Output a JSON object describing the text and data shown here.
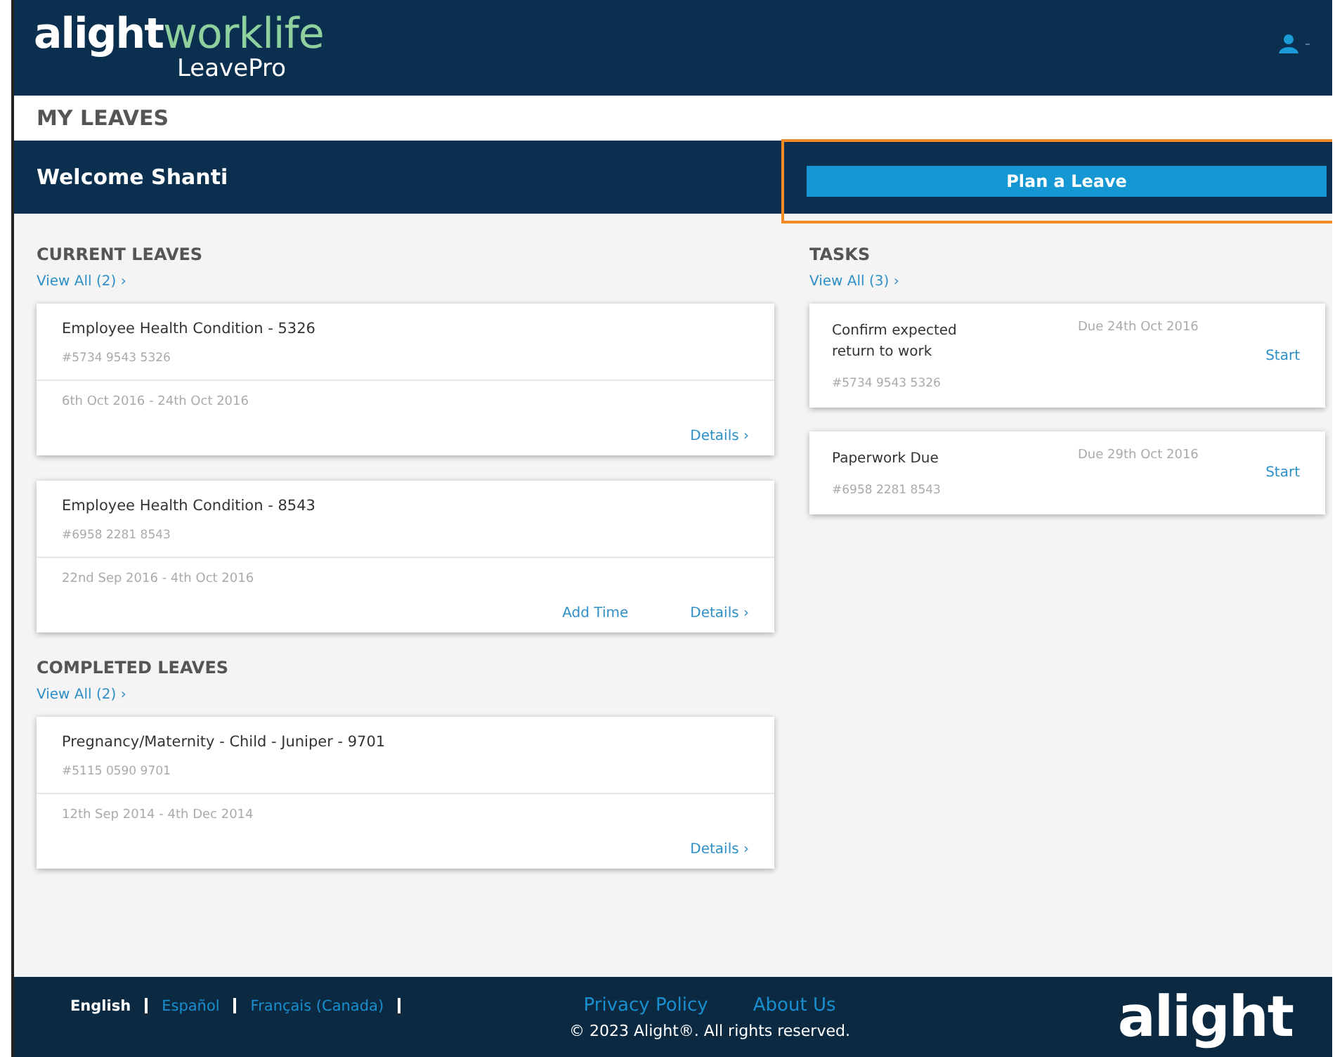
{
  "header": {
    "logo_main": "alight",
    "logo_accent": "worklife",
    "logo_sub": "LeavePro"
  },
  "page_title": "MY LEAVES",
  "welcome": {
    "text": "Welcome  Shanti",
    "button": "Plan a Leave",
    "highlighted": true
  },
  "current_leaves": {
    "title": "CURRENT LEAVES",
    "view_all": "View All (2) ›",
    "items": [
      {
        "title": "Employee Health Condition - 5326",
        "ref": "#5734 9543 5326",
        "dates": "6th Oct 2016 - 24th Oct 2016",
        "actions": [
          "Details ›"
        ]
      },
      {
        "title": "Employee Health Condition - 8543",
        "ref": "#6958 2281 8543",
        "dates": "22nd Sep 2016 - 4th Oct 2016",
        "actions": [
          "Add Time",
          "Details ›"
        ]
      }
    ]
  },
  "completed_leaves": {
    "title": "COMPLETED LEAVES",
    "view_all": "View All (2) ›",
    "items": [
      {
        "title": "Pregnancy/Maternity - Child - Juniper - 9701",
        "ref": "#5115 0590 9701",
        "dates": "12th Sep 2014 - 4th Dec 2014",
        "actions": [
          "Details ›"
        ]
      }
    ]
  },
  "tasks": {
    "title": "TASKS",
    "view_all": "View All (3) ›",
    "items": [
      {
        "title": "Confirm expected return to work",
        "ref": "#5734 9543 5326",
        "due": "Due 24th Oct 2016",
        "action": "Start"
      },
      {
        "title": "Paperwork Due",
        "ref": "#6958 2281 8543",
        "due": "Due 29th Oct 2016",
        "action": "Start"
      }
    ]
  },
  "footer": {
    "languages": [
      {
        "label": "English",
        "selected": true
      },
      {
        "label": "Español",
        "selected": false
      },
      {
        "label": "Français (Canada)",
        "selected": false
      }
    ],
    "links": [
      "Privacy Policy",
      "About Us"
    ],
    "copyright": "© 2023 Alight®. All rights reserved.",
    "logo": "alight"
  }
}
